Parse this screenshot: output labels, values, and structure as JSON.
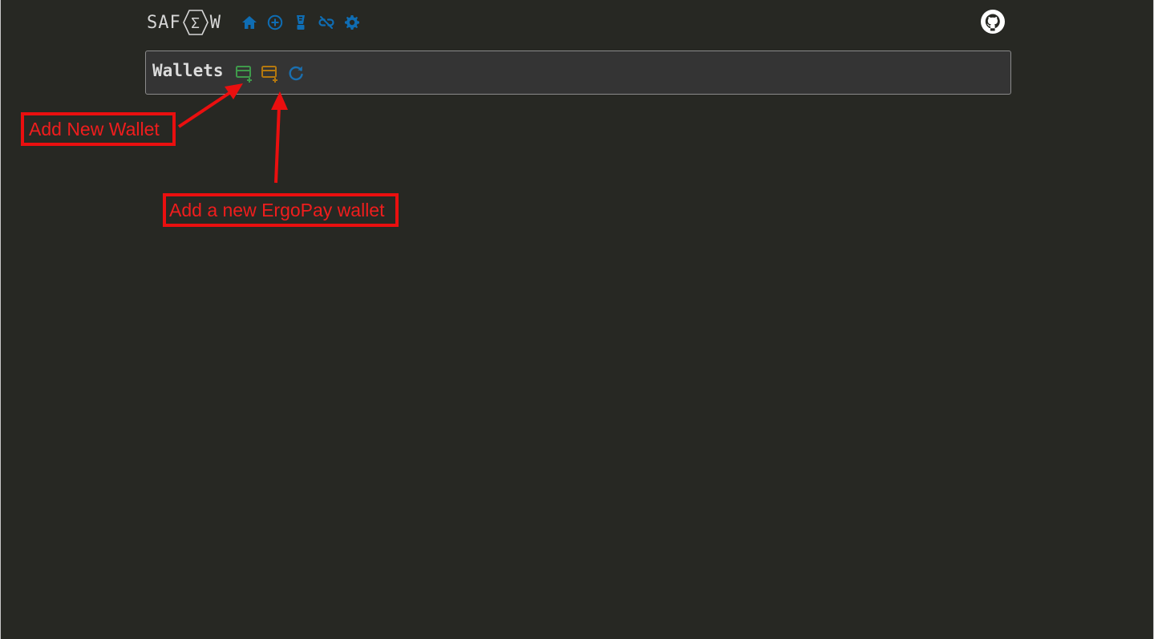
{
  "header": {
    "logo": {
      "left": "SAF",
      "hex_letter": "Σ",
      "right": "W"
    },
    "nav": [
      {
        "name": "home",
        "icon": "home-icon"
      },
      {
        "name": "add",
        "icon": "plus-circle-icon"
      },
      {
        "name": "mixer",
        "icon": "blender-icon"
      },
      {
        "name": "disconnect",
        "icon": "unlink-icon"
      },
      {
        "name": "settings",
        "icon": "gear-icon"
      }
    ],
    "github_icon": "github-icon"
  },
  "panel": {
    "title": "Wallets",
    "actions": [
      {
        "name": "add-new-wallet",
        "icon": "wallet-plus-icon",
        "color": "#3f9a4b"
      },
      {
        "name": "add-ergopay-wallet",
        "icon": "wallet-plus-icon",
        "color": "#b5780e"
      },
      {
        "name": "refresh",
        "icon": "refresh-icon",
        "color": "#1a6fb0"
      }
    ]
  },
  "annotations": {
    "add_new_wallet": "Add New Wallet",
    "add_ergopay_wallet": "Add a new ErgoPay wallet"
  },
  "colors": {
    "background": "#272823",
    "panel": "#343434",
    "nav_icon": "#0f6db3",
    "annotation": "#ea0f0f"
  }
}
